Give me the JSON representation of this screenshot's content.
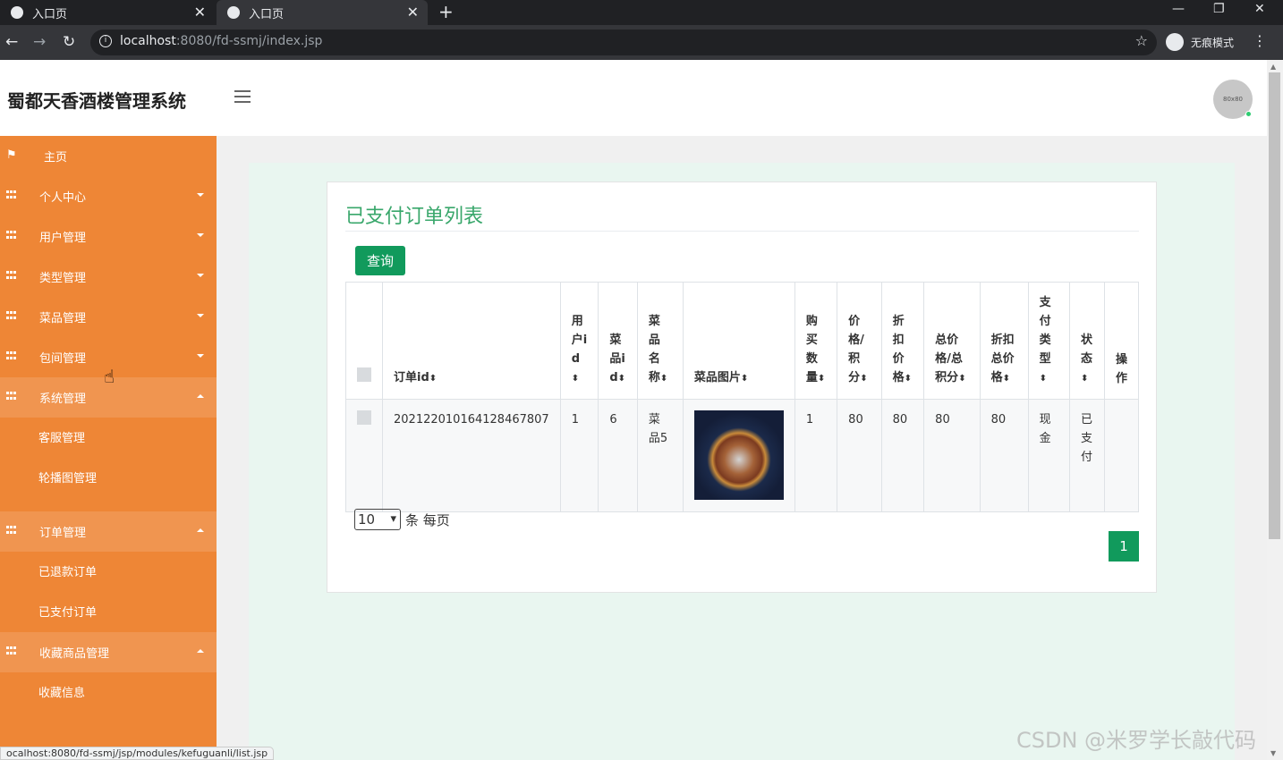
{
  "browser": {
    "tabs": [
      {
        "title": "入口页",
        "active": false
      },
      {
        "title": "入口页",
        "active": true
      }
    ],
    "url_host": "localhost",
    "url_rest": ":8080/fd-ssmj/index.jsp",
    "incognito_label": "无痕模式",
    "status_url": "ocalhost:8080/fd-ssmj/jsp/modules/kefuguanli/list.jsp"
  },
  "header": {
    "brand": "蜀都天香酒楼管理系统",
    "avatar_text": "80x80"
  },
  "sidebar": {
    "home": "主页",
    "items": [
      {
        "label": "个人中心",
        "expanded": false
      },
      {
        "label": "用户管理",
        "expanded": false
      },
      {
        "label": "类型管理",
        "expanded": false
      },
      {
        "label": "菜品管理",
        "expanded": false
      },
      {
        "label": "包间管理",
        "expanded": false
      },
      {
        "label": "系统管理",
        "expanded": true
      },
      {
        "label": "订单管理",
        "expanded": true
      },
      {
        "label": "收藏商品管理",
        "expanded": true
      }
    ],
    "sub_system": [
      "客服管理",
      "轮播图管理"
    ],
    "sub_order": [
      "已退款订单",
      "已支付订单"
    ],
    "sub_fav": [
      "收藏信息"
    ]
  },
  "main": {
    "title": "已支付订单列表",
    "query_button": "查询",
    "columns": [
      "订单id",
      "用户id",
      "菜品id",
      "菜品名称",
      "菜品图片",
      "购买数量",
      "价格/积分",
      "折扣价格",
      "总价格/总积分",
      "折扣总价格",
      "支付类型",
      "状态",
      "操作"
    ],
    "rows": [
      {
        "order_id": "202122010164128467807",
        "user_id": "1",
        "dish_id": "6",
        "dish_name": "菜品5",
        "quantity": "1",
        "price": "80",
        "discount_price": "80",
        "total": "80",
        "discount_total": "80",
        "pay_type": "现金",
        "status": "已支付"
      }
    ],
    "page_size": "10",
    "page_size_suffix": "条 每页",
    "current_page": "1"
  },
  "watermark": "CSDN @米罗学长敲代码",
  "colors": {
    "sidebar": "#ee8636",
    "accent_green": "#119a5c",
    "title_green": "#39a76b"
  }
}
